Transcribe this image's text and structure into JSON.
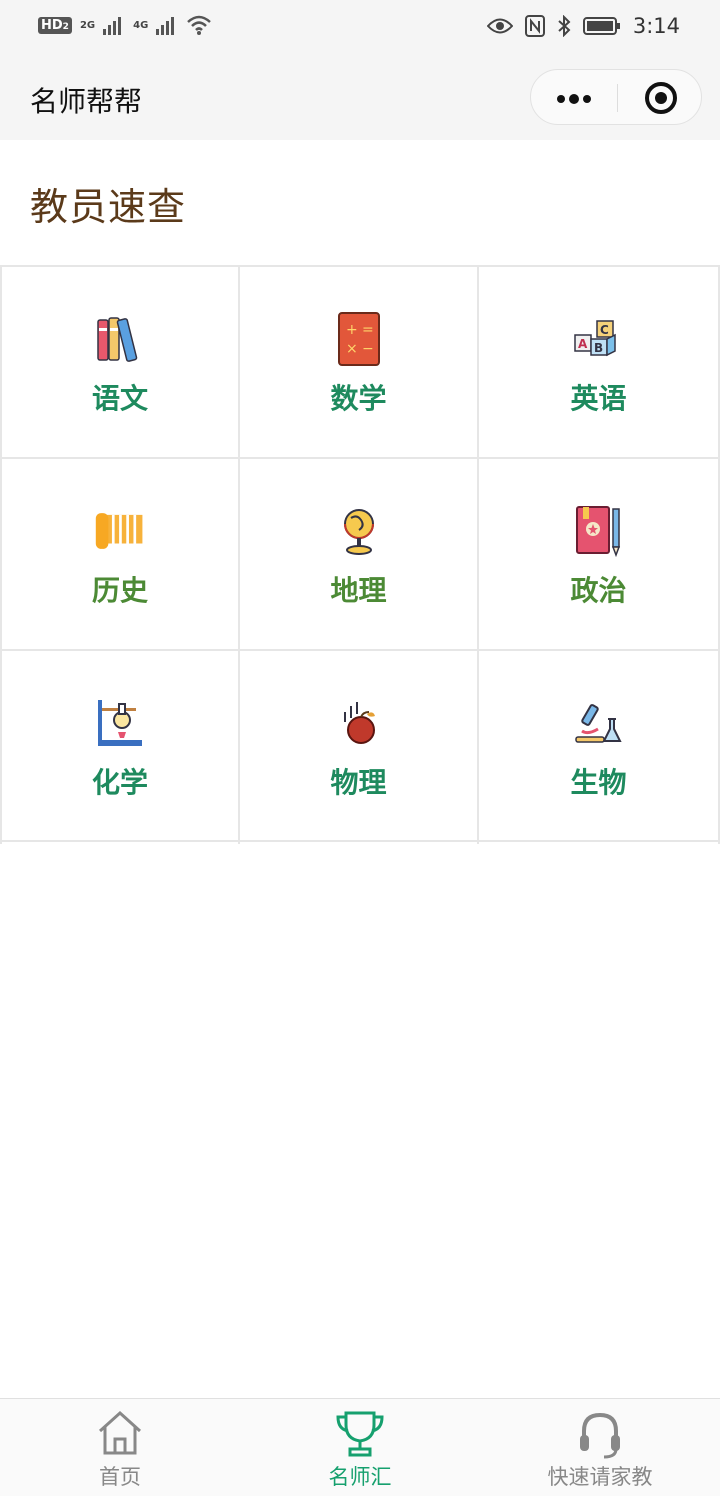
{
  "status_bar": {
    "hd": "HD",
    "hd_sub": "2",
    "net1": "2G",
    "net2": "4G",
    "time": "3:14"
  },
  "nav": {
    "title": "名师帮帮"
  },
  "section": {
    "title": "教员速查"
  },
  "subjects": [
    {
      "label": "语文",
      "icon": "books-icon",
      "color": "#1e8a5e"
    },
    {
      "label": "数学",
      "icon": "calculator-book-icon",
      "color": "#1e8a5e"
    },
    {
      "label": "英语",
      "icon": "abc-blocks-icon",
      "color": "#1e8a5e"
    },
    {
      "label": "历史",
      "icon": "scroll-icon",
      "color": "#4c8a35"
    },
    {
      "label": "地理",
      "icon": "globe-icon",
      "color": "#4c8a35"
    },
    {
      "label": "政治",
      "icon": "notebook-pencil-icon",
      "color": "#4c8a35"
    },
    {
      "label": "化学",
      "icon": "lab-flask-stand-icon",
      "color": "#1e8a5e"
    },
    {
      "label": "物理",
      "icon": "falling-apple-icon",
      "color": "#1e8a5e"
    },
    {
      "label": "生物",
      "icon": "microscope-icon",
      "color": "#1e8a5e"
    }
  ],
  "tabs": [
    {
      "label": "首页",
      "icon": "home-icon",
      "active": false
    },
    {
      "label": "名师汇",
      "icon": "trophy-icon",
      "active": true
    },
    {
      "label": "快速请家教",
      "icon": "headset-icon",
      "active": false
    }
  ],
  "colors": {
    "accent": "#16a06e",
    "title_bar": "#f5f5f5",
    "grid_border": "#e6e6e6"
  }
}
